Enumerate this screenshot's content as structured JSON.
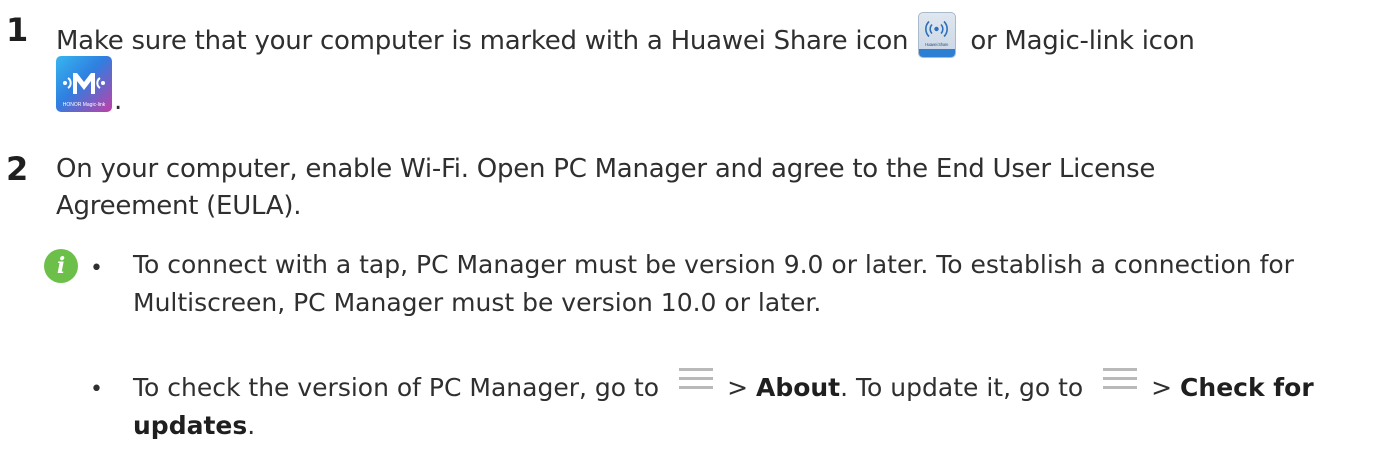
{
  "steps": [
    {
      "number": "1",
      "text_before": "Make sure that your computer is marked with a Huawei Share icon",
      "text_middle": "or Magic-link icon",
      "text_end": "."
    },
    {
      "number": "2",
      "text": "On your computer, enable Wi-Fi. Open PC Manager and agree to the End User License Agreement (EULA)."
    }
  ],
  "icons": {
    "huawei_share": "huawei-share-icon",
    "huawei_share_label": "Huawei Share",
    "magic_link": "magic-link-icon",
    "magic_link_label": "HONOR Magic-link",
    "note": "info-icon",
    "menu": "menu-icon"
  },
  "notes": [
    {
      "text": "To connect with a tap, PC Manager must be version 9.0 or later. To establish a connection for Multiscreen, PC Manager must be version 10.0 or later."
    },
    {
      "text_1": "To check the version of PC Manager, go to",
      "bold_1": "About",
      "text_2": ". To update it, go to",
      "bold_2": "Check for updates",
      "text_3": "."
    }
  ],
  "colors": {
    "note_icon": "#6cc04a",
    "huawei_share_bar": "#2d7fd3",
    "menu_lines": "#b9b9b9"
  }
}
